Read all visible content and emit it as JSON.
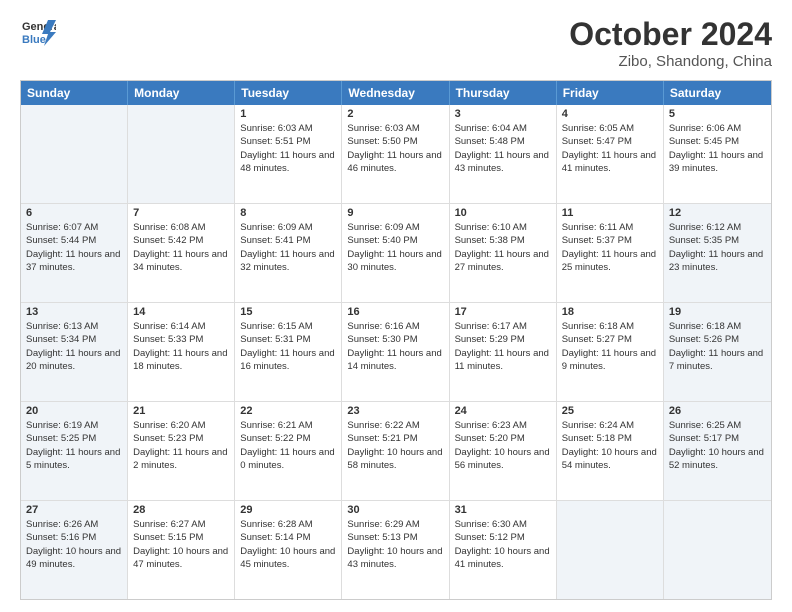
{
  "header": {
    "logo_line1": "General",
    "logo_line2": "Blue",
    "month": "October 2024",
    "location": "Zibo, Shandong, China"
  },
  "days_of_week": [
    "Sunday",
    "Monday",
    "Tuesday",
    "Wednesday",
    "Thursday",
    "Friday",
    "Saturday"
  ],
  "weeks": [
    [
      {
        "day": "",
        "sunrise": "",
        "sunset": "",
        "daylight": "",
        "shaded": true
      },
      {
        "day": "",
        "sunrise": "",
        "sunset": "",
        "daylight": "",
        "shaded": true
      },
      {
        "day": "1",
        "sunrise": "Sunrise: 6:03 AM",
        "sunset": "Sunset: 5:51 PM",
        "daylight": "Daylight: 11 hours and 48 minutes.",
        "shaded": false
      },
      {
        "day": "2",
        "sunrise": "Sunrise: 6:03 AM",
        "sunset": "Sunset: 5:50 PM",
        "daylight": "Daylight: 11 hours and 46 minutes.",
        "shaded": false
      },
      {
        "day": "3",
        "sunrise": "Sunrise: 6:04 AM",
        "sunset": "Sunset: 5:48 PM",
        "daylight": "Daylight: 11 hours and 43 minutes.",
        "shaded": false
      },
      {
        "day": "4",
        "sunrise": "Sunrise: 6:05 AM",
        "sunset": "Sunset: 5:47 PM",
        "daylight": "Daylight: 11 hours and 41 minutes.",
        "shaded": false
      },
      {
        "day": "5",
        "sunrise": "Sunrise: 6:06 AM",
        "sunset": "Sunset: 5:45 PM",
        "daylight": "Daylight: 11 hours and 39 minutes.",
        "shaded": false
      }
    ],
    [
      {
        "day": "6",
        "sunrise": "Sunrise: 6:07 AM",
        "sunset": "Sunset: 5:44 PM",
        "daylight": "Daylight: 11 hours and 37 minutes.",
        "shaded": true
      },
      {
        "day": "7",
        "sunrise": "Sunrise: 6:08 AM",
        "sunset": "Sunset: 5:42 PM",
        "daylight": "Daylight: 11 hours and 34 minutes.",
        "shaded": false
      },
      {
        "day": "8",
        "sunrise": "Sunrise: 6:09 AM",
        "sunset": "Sunset: 5:41 PM",
        "daylight": "Daylight: 11 hours and 32 minutes.",
        "shaded": false
      },
      {
        "day": "9",
        "sunrise": "Sunrise: 6:09 AM",
        "sunset": "Sunset: 5:40 PM",
        "daylight": "Daylight: 11 hours and 30 minutes.",
        "shaded": false
      },
      {
        "day": "10",
        "sunrise": "Sunrise: 6:10 AM",
        "sunset": "Sunset: 5:38 PM",
        "daylight": "Daylight: 11 hours and 27 minutes.",
        "shaded": false
      },
      {
        "day": "11",
        "sunrise": "Sunrise: 6:11 AM",
        "sunset": "Sunset: 5:37 PM",
        "daylight": "Daylight: 11 hours and 25 minutes.",
        "shaded": false
      },
      {
        "day": "12",
        "sunrise": "Sunrise: 6:12 AM",
        "sunset": "Sunset: 5:35 PM",
        "daylight": "Daylight: 11 hours and 23 minutes.",
        "shaded": true
      }
    ],
    [
      {
        "day": "13",
        "sunrise": "Sunrise: 6:13 AM",
        "sunset": "Sunset: 5:34 PM",
        "daylight": "Daylight: 11 hours and 20 minutes.",
        "shaded": true
      },
      {
        "day": "14",
        "sunrise": "Sunrise: 6:14 AM",
        "sunset": "Sunset: 5:33 PM",
        "daylight": "Daylight: 11 hours and 18 minutes.",
        "shaded": false
      },
      {
        "day": "15",
        "sunrise": "Sunrise: 6:15 AM",
        "sunset": "Sunset: 5:31 PM",
        "daylight": "Daylight: 11 hours and 16 minutes.",
        "shaded": false
      },
      {
        "day": "16",
        "sunrise": "Sunrise: 6:16 AM",
        "sunset": "Sunset: 5:30 PM",
        "daylight": "Daylight: 11 hours and 14 minutes.",
        "shaded": false
      },
      {
        "day": "17",
        "sunrise": "Sunrise: 6:17 AM",
        "sunset": "Sunset: 5:29 PM",
        "daylight": "Daylight: 11 hours and 11 minutes.",
        "shaded": false
      },
      {
        "day": "18",
        "sunrise": "Sunrise: 6:18 AM",
        "sunset": "Sunset: 5:27 PM",
        "daylight": "Daylight: 11 hours and 9 minutes.",
        "shaded": false
      },
      {
        "day": "19",
        "sunrise": "Sunrise: 6:18 AM",
        "sunset": "Sunset: 5:26 PM",
        "daylight": "Daylight: 11 hours and 7 minutes.",
        "shaded": true
      }
    ],
    [
      {
        "day": "20",
        "sunrise": "Sunrise: 6:19 AM",
        "sunset": "Sunset: 5:25 PM",
        "daylight": "Daylight: 11 hours and 5 minutes.",
        "shaded": true
      },
      {
        "day": "21",
        "sunrise": "Sunrise: 6:20 AM",
        "sunset": "Sunset: 5:23 PM",
        "daylight": "Daylight: 11 hours and 2 minutes.",
        "shaded": false
      },
      {
        "day": "22",
        "sunrise": "Sunrise: 6:21 AM",
        "sunset": "Sunset: 5:22 PM",
        "daylight": "Daylight: 11 hours and 0 minutes.",
        "shaded": false
      },
      {
        "day": "23",
        "sunrise": "Sunrise: 6:22 AM",
        "sunset": "Sunset: 5:21 PM",
        "daylight": "Daylight: 10 hours and 58 minutes.",
        "shaded": false
      },
      {
        "day": "24",
        "sunrise": "Sunrise: 6:23 AM",
        "sunset": "Sunset: 5:20 PM",
        "daylight": "Daylight: 10 hours and 56 minutes.",
        "shaded": false
      },
      {
        "day": "25",
        "sunrise": "Sunrise: 6:24 AM",
        "sunset": "Sunset: 5:18 PM",
        "daylight": "Daylight: 10 hours and 54 minutes.",
        "shaded": false
      },
      {
        "day": "26",
        "sunrise": "Sunrise: 6:25 AM",
        "sunset": "Sunset: 5:17 PM",
        "daylight": "Daylight: 10 hours and 52 minutes.",
        "shaded": true
      }
    ],
    [
      {
        "day": "27",
        "sunrise": "Sunrise: 6:26 AM",
        "sunset": "Sunset: 5:16 PM",
        "daylight": "Daylight: 10 hours and 49 minutes.",
        "shaded": true
      },
      {
        "day": "28",
        "sunrise": "Sunrise: 6:27 AM",
        "sunset": "Sunset: 5:15 PM",
        "daylight": "Daylight: 10 hours and 47 minutes.",
        "shaded": false
      },
      {
        "day": "29",
        "sunrise": "Sunrise: 6:28 AM",
        "sunset": "Sunset: 5:14 PM",
        "daylight": "Daylight: 10 hours and 45 minutes.",
        "shaded": false
      },
      {
        "day": "30",
        "sunrise": "Sunrise: 6:29 AM",
        "sunset": "Sunset: 5:13 PM",
        "daylight": "Daylight: 10 hours and 43 minutes.",
        "shaded": false
      },
      {
        "day": "31",
        "sunrise": "Sunrise: 6:30 AM",
        "sunset": "Sunset: 5:12 PM",
        "daylight": "Daylight: 10 hours and 41 minutes.",
        "shaded": false
      },
      {
        "day": "",
        "sunrise": "",
        "sunset": "",
        "daylight": "",
        "shaded": true
      },
      {
        "day": "",
        "sunrise": "",
        "sunset": "",
        "daylight": "",
        "shaded": true
      }
    ]
  ]
}
